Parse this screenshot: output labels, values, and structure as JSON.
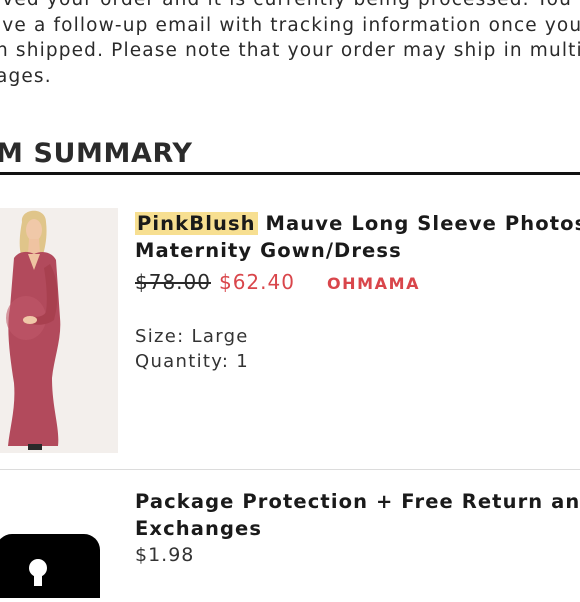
{
  "intro": {
    "lines": [
      "ived your order and it is currently being processed. You",
      "ive a follow-up email with tracking information once you",
      "n shipped. Please note that your order may ship in multi",
      "ages."
    ]
  },
  "section": {
    "title": "M SUMMARY"
  },
  "items": [
    {
      "brand": "PinkBlush",
      "title_rest": "Mauve Long Sleeve Photosh",
      "title_line2": "Maternity Gown/Dress",
      "original_price": "$78.00",
      "sale_price": "$62.40",
      "promo": "OHMAMA",
      "size": "Size: Large",
      "quantity": "Quantity: 1"
    },
    {
      "title_line1": "Package Protection + Free Return and",
      "title_line2": "Exchanges",
      "price": "$1.98",
      "icon": "package-protection-icon"
    }
  ],
  "colors": {
    "sale": "#d9464b",
    "highlight": "#f7df91",
    "dress": "#b24a5c"
  }
}
